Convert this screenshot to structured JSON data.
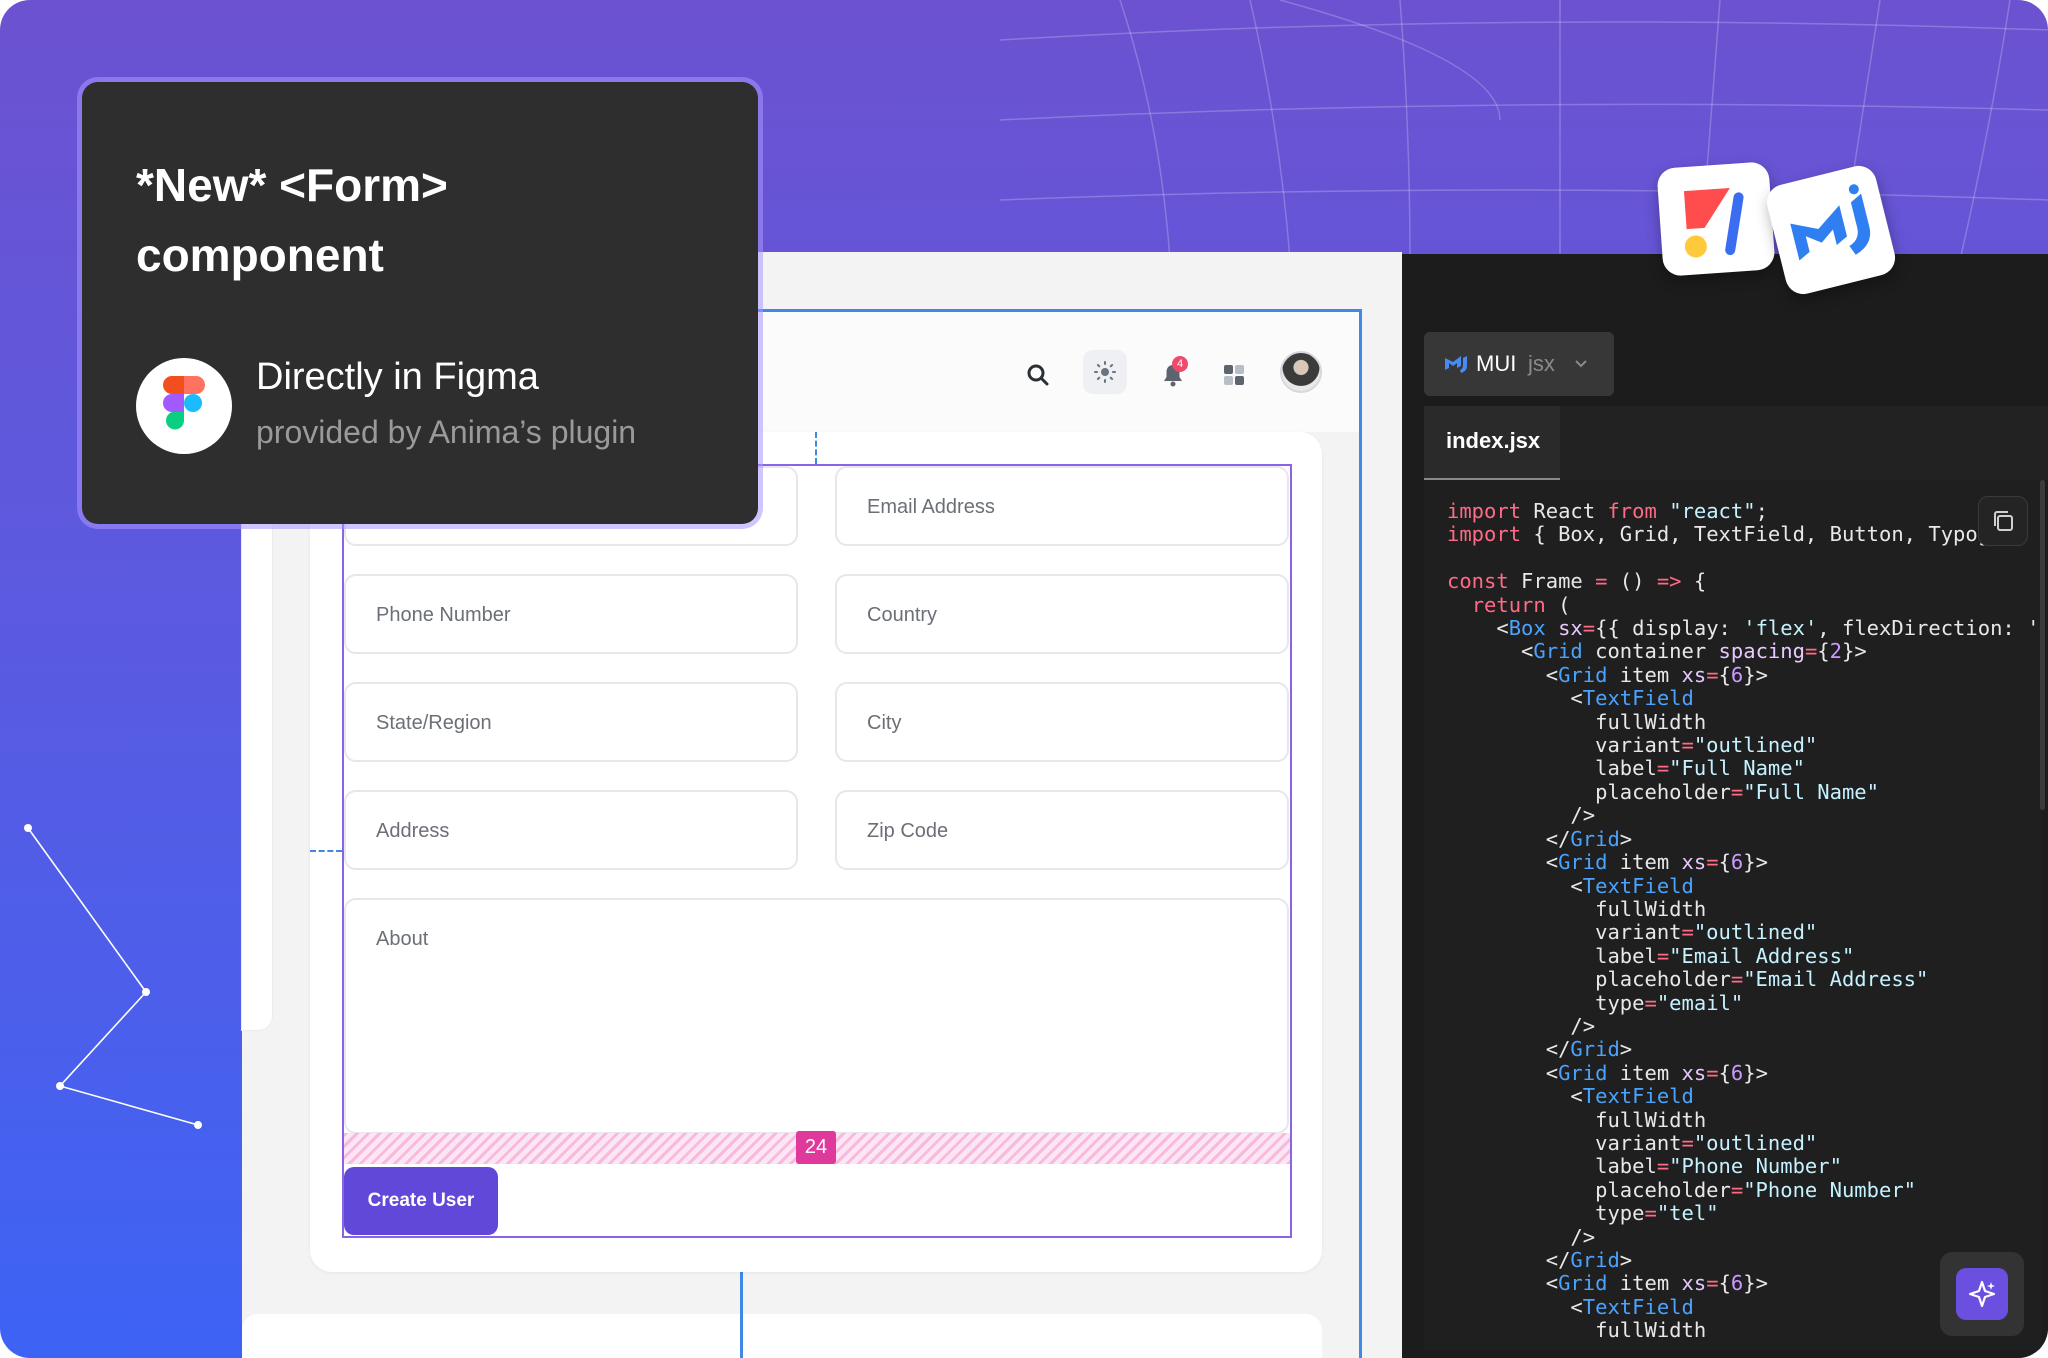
{
  "promo": {
    "title_line1": "*New* <Form>",
    "title_line2": "component",
    "subtitle": "Directly in Figma",
    "caption": "provided by Anima’s plugin"
  },
  "topbar": {
    "notification_count": "4",
    "icons": [
      "search-icon",
      "theme-toggle-icon",
      "bell-icon",
      "apps-grid-icon",
      "avatar"
    ]
  },
  "form": {
    "fields": [
      {
        "label": "Email Address"
      },
      {
        "label": "Phone Number"
      },
      {
        "label": "Country"
      },
      {
        "label": "State/Region"
      },
      {
        "label": "City"
      },
      {
        "label": "Address"
      },
      {
        "label": "Zip Code"
      },
      {
        "label": "About"
      }
    ],
    "spacing_value": "24",
    "submit_label": "Create User"
  },
  "code_panel": {
    "framework": "MUI",
    "language": "jsx",
    "file_tab": "index.jsx",
    "code_lines": [
      "import React from \"react\";",
      "import { Box, Grid, TextField, Button, Typog",
      "",
      "const Frame = () => {",
      "  return (",
      "    <Box sx={{ display: 'flex', flexDirection: '",
      "      <Grid container spacing={2}>",
      "        <Grid item xs={6}>",
      "          <TextField",
      "            fullWidth",
      "            variant=\"outlined\"",
      "            label=\"Full Name\"",
      "            placeholder=\"Full Name\"",
      "          />",
      "        </Grid>",
      "        <Grid item xs={6}>",
      "          <TextField",
      "            fullWidth",
      "            variant=\"outlined\"",
      "            label=\"Email Address\"",
      "            placeholder=\"Email Address\"",
      "            type=\"email\"",
      "          />",
      "        </Grid>",
      "        <Grid item xs={6}>",
      "          <TextField",
      "            fullWidth",
      "            variant=\"outlined\"",
      "            label=\"Phone Number\"",
      "            placeholder=\"Phone Number\"",
      "            type=\"tel\"",
      "          />",
      "        </Grid>",
      "        <Grid item xs={6}>",
      "          <TextField",
      "            fullWidth"
    ]
  },
  "colors": {
    "brand_purple": "#6248d8",
    "selection_blue": "#3f88e6",
    "spacing_pink": "#e0399c"
  }
}
